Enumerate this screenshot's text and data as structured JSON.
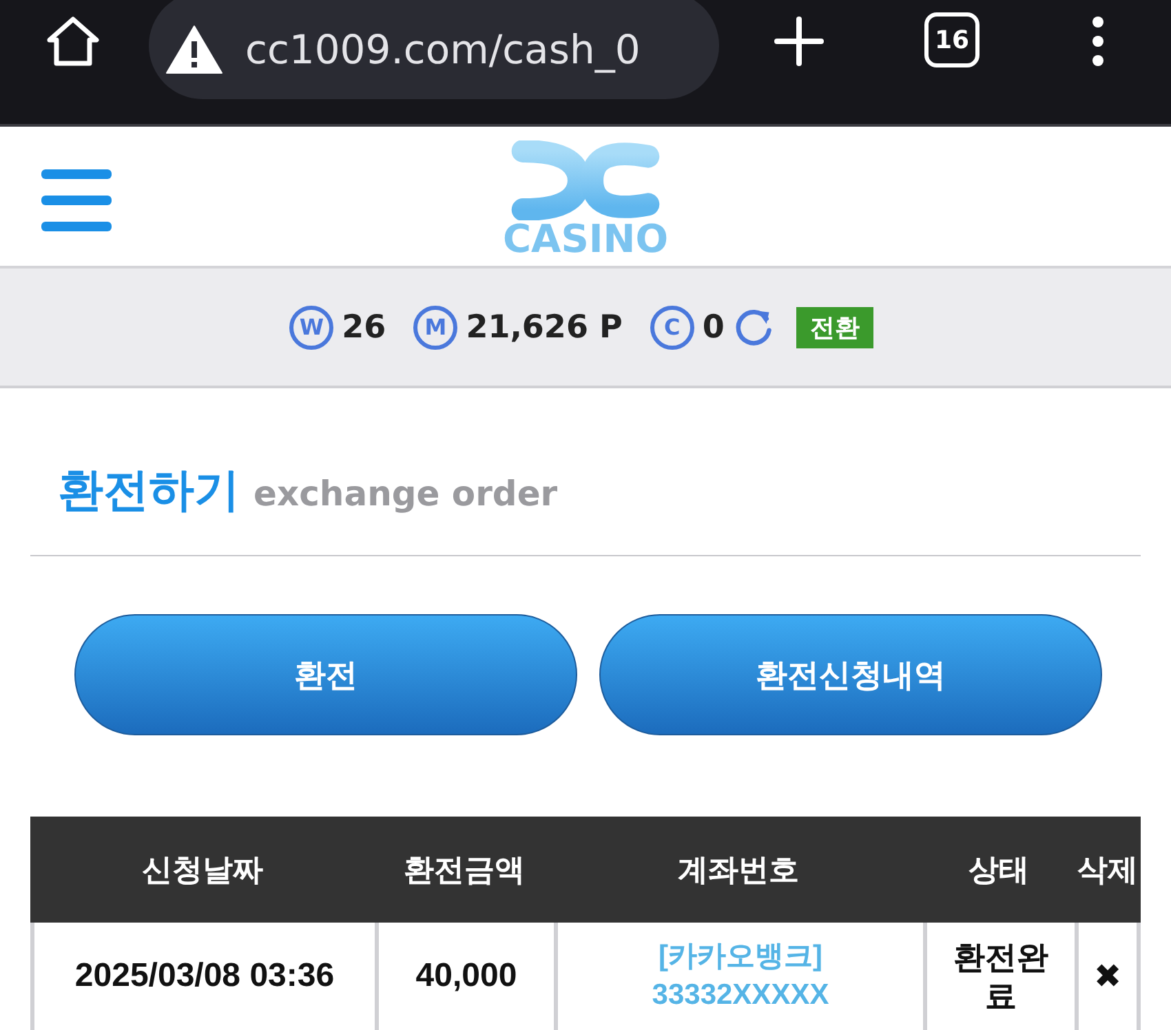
{
  "browser": {
    "url": "cc1009.com/cash_0",
    "tab_count": "16"
  },
  "header": {
    "logo_text": "CASINO"
  },
  "balances": [
    {
      "symbol": "W",
      "value": "26"
    },
    {
      "symbol": "M",
      "value": "21,626 P"
    },
    {
      "symbol": "C",
      "value": "0"
    }
  ],
  "convert_button": "전환",
  "page_title": {
    "title": "환전하기",
    "subtitle": "exchange order"
  },
  "buttons": [
    "환전",
    "환전신청내역"
  ],
  "table": {
    "columns": [
      "신청날짜",
      "환전금액",
      "계좌번호",
      "상태",
      "삭제"
    ],
    "rows": [
      {
        "date": "2025/03/08 03:36",
        "amount": "40,000",
        "bank": "[카카오뱅크]",
        "account": "33332XXXXX",
        "status": "환전완료",
        "delete": "✖"
      }
    ]
  }
}
